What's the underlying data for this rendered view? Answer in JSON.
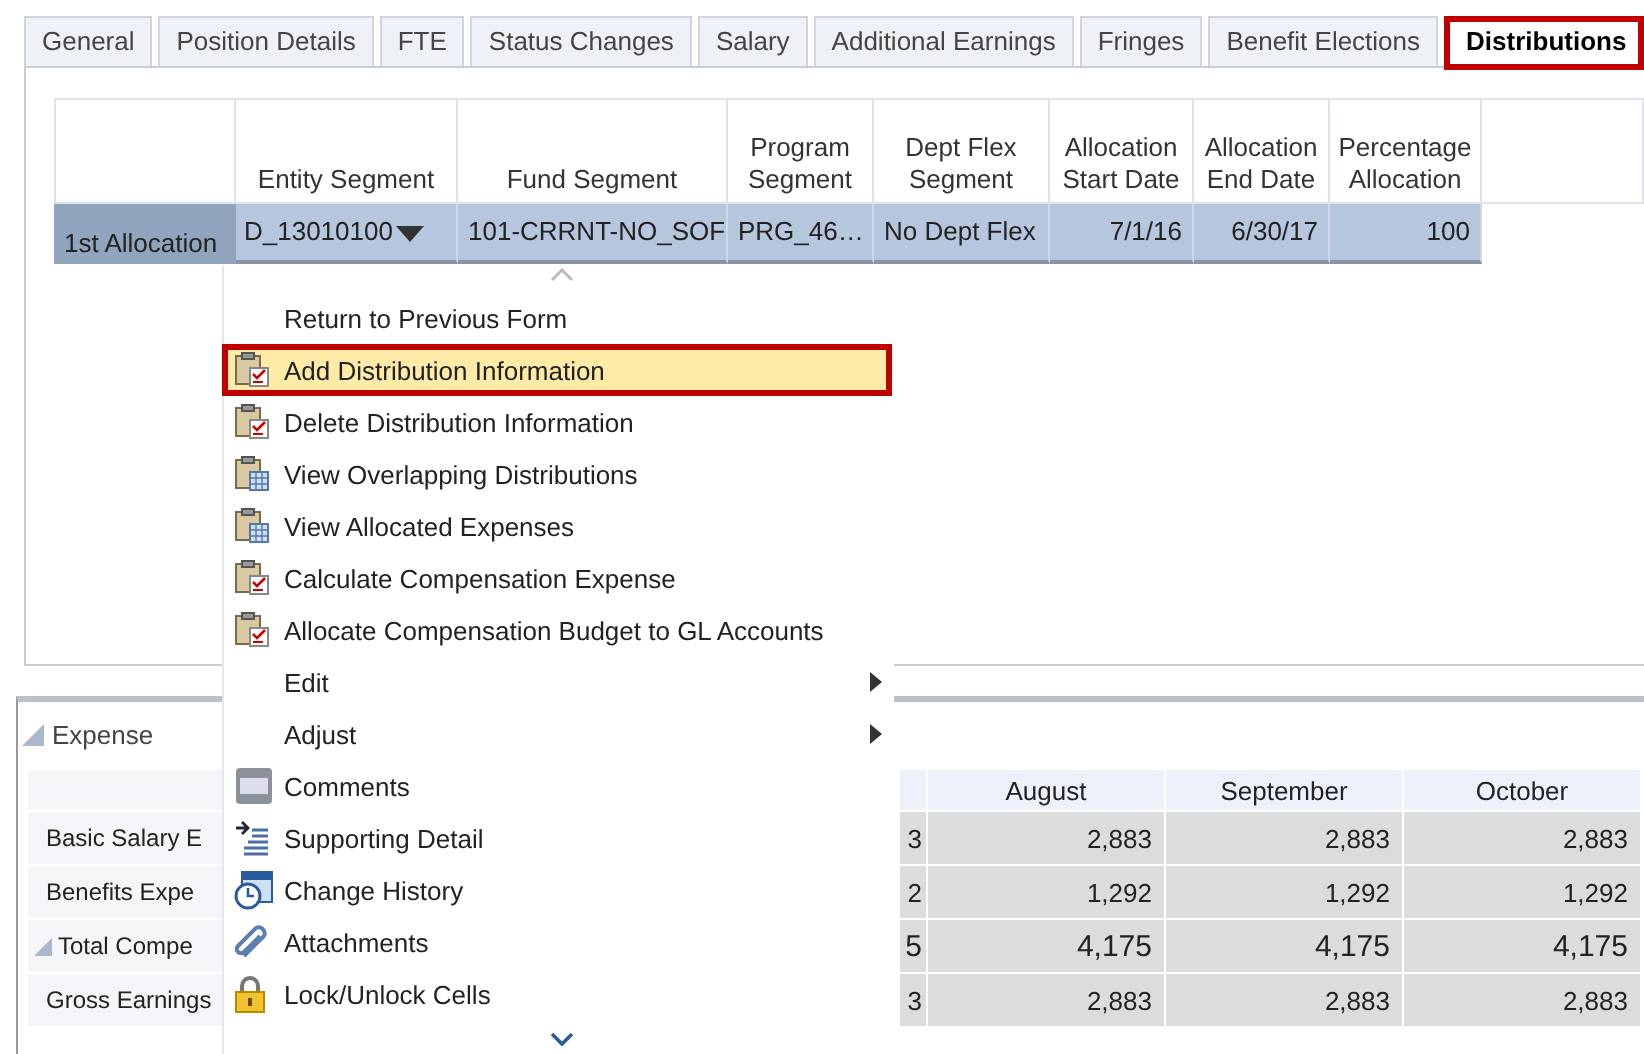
{
  "tabs": [
    {
      "label": "General",
      "selected": false
    },
    {
      "label": "Position Details",
      "selected": false
    },
    {
      "label": "FTE",
      "selected": false
    },
    {
      "label": "Status Changes",
      "selected": false
    },
    {
      "label": "Salary",
      "selected": false
    },
    {
      "label": "Additional Earnings",
      "selected": false
    },
    {
      "label": "Fringes",
      "selected": false
    },
    {
      "label": "Benefit Elections",
      "selected": false
    },
    {
      "label": "Distributions",
      "selected": true
    }
  ],
  "allocation_table": {
    "columns": [
      "Entity Segment",
      "Fund Segment",
      "Program Segment",
      "Dept Flex Segment",
      "Allocation Start Date",
      "Allocation End Date",
      "Percentage Allocation"
    ],
    "rows": [
      {
        "label": "1st Allocation",
        "cells": [
          "D_13010100",
          "101-CRRNT-NO_SOF",
          "PRG_46…",
          "No Dept Flex",
          "7/1/16",
          "6/30/17",
          "100"
        ]
      }
    ]
  },
  "context_menu": {
    "items": [
      {
        "label": "Return to Previous Form",
        "kind": "plain",
        "selected": false
      },
      {
        "label": "Add Distribution Information",
        "kind": "task",
        "selected": true
      },
      {
        "label": "Delete Distribution Information",
        "kind": "task",
        "selected": false
      },
      {
        "label": "View Overlapping Distributions",
        "kind": "view",
        "selected": false
      },
      {
        "label": "View Allocated Expenses",
        "kind": "view",
        "selected": false
      },
      {
        "label": "Calculate Compensation Expense",
        "kind": "task",
        "selected": false
      },
      {
        "label": "Allocate Compensation Budget to GL Accounts",
        "kind": "task",
        "selected": false
      },
      {
        "label": "Edit",
        "kind": "submenu",
        "selected": false
      },
      {
        "label": "Adjust",
        "kind": "submenu",
        "selected": false
      },
      {
        "label": "Comments",
        "kind": "comments",
        "selected": false
      },
      {
        "label": "Supporting Detail",
        "kind": "detail",
        "selected": false
      },
      {
        "label": "Change History",
        "kind": "history",
        "selected": false
      },
      {
        "label": "Attachments",
        "kind": "attach",
        "selected": false
      },
      {
        "label": "Lock/Unlock Cells",
        "kind": "lock",
        "selected": false
      }
    ]
  },
  "expense": {
    "title": "Expense",
    "columns": [
      "August",
      "September",
      "October"
    ],
    "rows": [
      {
        "label": "Basic Salary E",
        "kind": "line",
        "values": [
          "3",
          "2,883",
          "2,883",
          "2,883"
        ]
      },
      {
        "label": "Benefits Expe",
        "kind": "line",
        "values": [
          "2",
          "1,292",
          "1,292",
          "1,292"
        ]
      },
      {
        "label": "Total Compe",
        "kind": "group",
        "values": [
          "5",
          "4,175",
          "4,175",
          "4,175"
        ]
      },
      {
        "label": "Gross Earnings",
        "kind": "line",
        "values": [
          "3",
          "2,883",
          "2,883",
          "2,883"
        ]
      }
    ]
  }
}
